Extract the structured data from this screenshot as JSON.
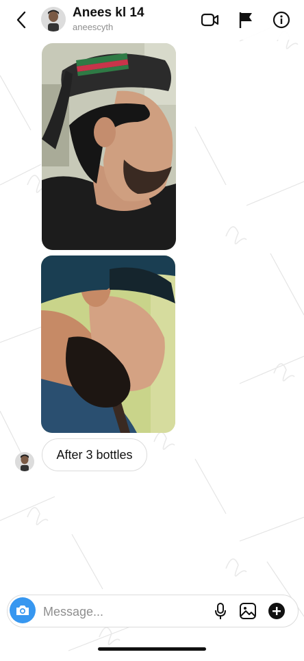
{
  "header": {
    "title": "Anees kl 14",
    "username": "aneescyth",
    "icons": [
      "back-icon",
      "video-call-icon",
      "flag-icon",
      "info-icon"
    ]
  },
  "messages": [
    {
      "type": "photo",
      "content": "photo of man in backwards cap, side profile",
      "colors": {
        "cap": "#2b2b2b",
        "stripe_red": "#c8344a",
        "stripe_green": "#2f7a45"
      }
    },
    {
      "type": "photo",
      "content": "photo of man with beard looking down, side profile",
      "colors": {
        "shirt": "#2a4f70",
        "wall": "#c9d48a"
      }
    },
    {
      "type": "text",
      "text": "After 3 bottles"
    }
  ],
  "composer": {
    "placeholder": "Message...",
    "icons": [
      "camera-icon",
      "microphone-icon",
      "gallery-icon",
      "add-icon"
    ]
  },
  "colors": {
    "accent": "#3797f0",
    "border": "#dbdbdb",
    "muted": "#8e8e8e"
  }
}
